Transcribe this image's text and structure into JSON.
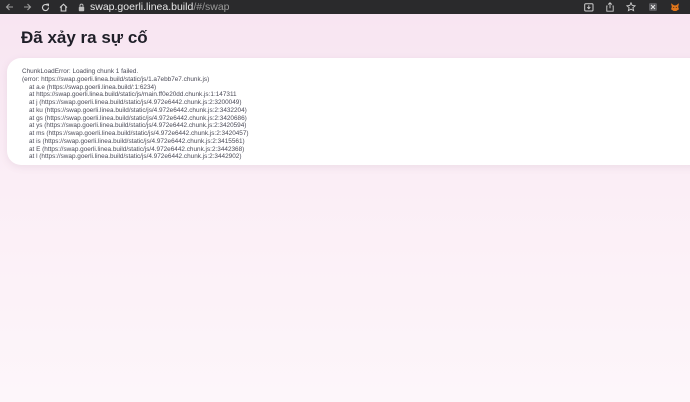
{
  "browser": {
    "url_host": "swap.goerli.linea.build",
    "url_path": "/#/swap",
    "icons": [
      "back-icon",
      "forward-icon",
      "reload-icon",
      "home-icon",
      "lock-icon",
      "install-app-icon",
      "share-icon",
      "bookmark-star-icon",
      "extension-icon",
      "metamask-fox-icon"
    ]
  },
  "page": {
    "title": "Đã xảy ra sự cố"
  },
  "error": {
    "lines": [
      "ChunkLoadError: Loading chunk 1 failed.",
      "(error: https://swap.goerli.linea.build/static/js/1.a7ebb7e7.chunk.js)",
      "at a.e (https://swap.goerli.linea.build/:1:6234)",
      "at https://swap.goerli.linea.build/static/js/main.ff0e20dd.chunk.js:1:147311",
      "at j (https://swap.goerli.linea.build/static/js/4.972e6442.chunk.js:2:3200049)",
      "at ku (https://swap.goerli.linea.build/static/js/4.972e6442.chunk.js:2:3432204)",
      "at gs (https://swap.goerli.linea.build/static/js/4.972e6442.chunk.js:2:3420686)",
      "at ys (https://swap.goerli.linea.build/static/js/4.972e6442.chunk.js:2:3420594)",
      "at ms (https://swap.goerli.linea.build/static/js/4.972e6442.chunk.js:2:3420457)",
      "at is (https://swap.goerli.linea.build/static/js/4.972e6442.chunk.js:2:3415561)",
      "at E (https://swap.goerli.linea.build/static/js/4.972e6442.chunk.js:2:3442368)",
      "at l (https://swap.goerli.linea.build/static/js/4.972e6442.chunk.js:2:3442902)"
    ]
  },
  "colors": {
    "toolbar": "#2a2a2c",
    "page_top": "#f7e4f1",
    "page_bottom": "#fdf6fa",
    "title": "#1f1f28",
    "error_text": "#4b4b58"
  }
}
